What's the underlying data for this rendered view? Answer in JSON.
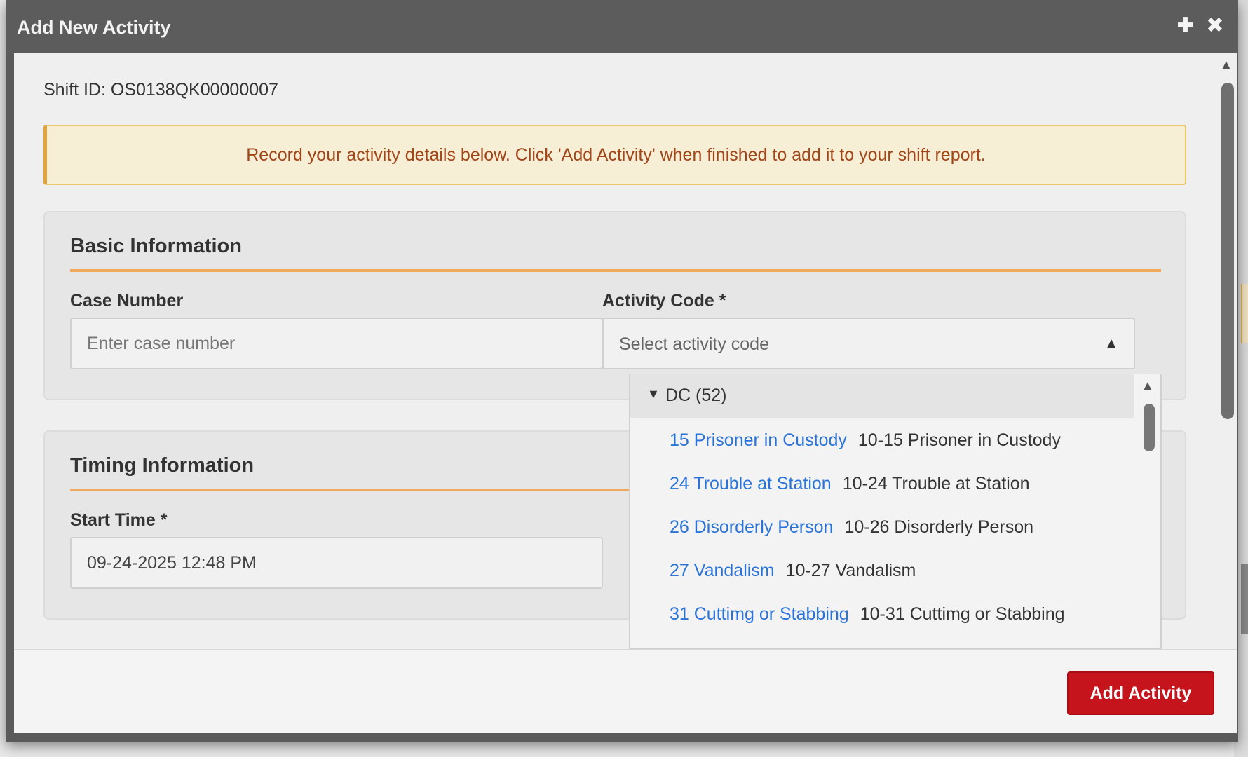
{
  "dialog": {
    "title": "Add New Activity",
    "actions": {
      "expand_icon": "plus-icon",
      "close_icon": "close-icon"
    }
  },
  "shift": {
    "label": "Shift ID: OS0138QK00000007"
  },
  "notice": "Record your activity details below. Click 'Add Activity' when finished to add it to your shift report.",
  "basic_info": {
    "title": "Basic Information",
    "case_number": {
      "label": "Case Number",
      "placeholder": "Enter case number",
      "value": ""
    },
    "activity_code": {
      "label": "Activity Code *",
      "placeholder": "Select activity code"
    }
  },
  "timing_info": {
    "title": "Timing Information",
    "start_time": {
      "label": "Start Time *",
      "value": "09-24-2025 12:48 PM"
    }
  },
  "dropdown": {
    "group": "DC (52)",
    "items": [
      {
        "code": "15 Prisoner in Custody",
        "desc": "10-15 Prisoner in Custody"
      },
      {
        "code": "24 Trouble at Station",
        "desc": "10-24 Trouble at Station"
      },
      {
        "code": "26 Disorderly Person",
        "desc": "10-26 Disorderly Person"
      },
      {
        "code": "27 Vandalism",
        "desc": "10-27 Vandalism"
      },
      {
        "code": "31 Cuttimg or Stabbing",
        "desc": "10-31 Cuttimg or Stabbing"
      }
    ]
  },
  "footer": {
    "add_button": "Add Activity"
  },
  "colors": {
    "accent": "#c5141c",
    "link": "#2a73d8",
    "section_rule": "#f0a85a",
    "notice_text": "#a2461a"
  }
}
